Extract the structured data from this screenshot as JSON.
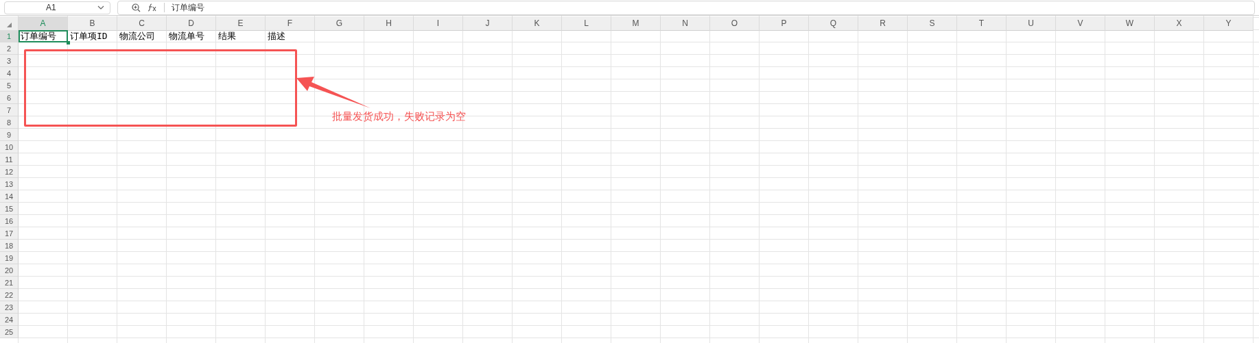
{
  "name_box": {
    "value": "A1"
  },
  "formula_bar": {
    "value": "订单编号"
  },
  "columns": [
    {
      "label": "A",
      "selected": true
    },
    {
      "label": "B",
      "selected": false
    },
    {
      "label": "C",
      "selected": false
    },
    {
      "label": "D",
      "selected": false
    },
    {
      "label": "E",
      "selected": false
    },
    {
      "label": "F",
      "selected": false
    },
    {
      "label": "G",
      "selected": false
    },
    {
      "label": "H",
      "selected": false
    },
    {
      "label": "I",
      "selected": false
    },
    {
      "label": "J",
      "selected": false
    },
    {
      "label": "K",
      "selected": false
    },
    {
      "label": "L",
      "selected": false
    },
    {
      "label": "M",
      "selected": false
    },
    {
      "label": "N",
      "selected": false
    },
    {
      "label": "O",
      "selected": false
    },
    {
      "label": "P",
      "selected": false
    },
    {
      "label": "Q",
      "selected": false
    },
    {
      "label": "R",
      "selected": false
    },
    {
      "label": "S",
      "selected": false
    },
    {
      "label": "T",
      "selected": false
    },
    {
      "label": "U",
      "selected": false
    },
    {
      "label": "V",
      "selected": false
    },
    {
      "label": "W",
      "selected": false
    },
    {
      "label": "X",
      "selected": false
    },
    {
      "label": "Y",
      "selected": false
    }
  ],
  "rows": [
    {
      "label": "1",
      "selected": true,
      "cells": [
        {
          "text": "订单编号",
          "selected": true
        },
        {
          "text": "订单项ID",
          "selected": false
        },
        {
          "text": "物流公司",
          "selected": false
        },
        {
          "text": "物流单号",
          "selected": false
        },
        {
          "text": "结果",
          "selected": false
        },
        {
          "text": "描述",
          "selected": false
        }
      ]
    },
    {
      "label": "2",
      "selected": false
    },
    {
      "label": "3",
      "selected": false
    },
    {
      "label": "4",
      "selected": false
    },
    {
      "label": "5",
      "selected": false
    },
    {
      "label": "6",
      "selected": false
    },
    {
      "label": "7",
      "selected": false
    },
    {
      "label": "8",
      "selected": false
    },
    {
      "label": "9",
      "selected": false
    },
    {
      "label": "10",
      "selected": false
    },
    {
      "label": "11",
      "selected": false
    },
    {
      "label": "12",
      "selected": false
    },
    {
      "label": "13",
      "selected": false
    },
    {
      "label": "14",
      "selected": false
    },
    {
      "label": "15",
      "selected": false
    },
    {
      "label": "16",
      "selected": false
    },
    {
      "label": "17",
      "selected": false
    },
    {
      "label": "18",
      "selected": false
    },
    {
      "label": "19",
      "selected": false
    },
    {
      "label": "20",
      "selected": false
    },
    {
      "label": "21",
      "selected": false
    },
    {
      "label": "22",
      "selected": false
    },
    {
      "label": "23",
      "selected": false
    },
    {
      "label": "24",
      "selected": false
    },
    {
      "label": "25",
      "selected": false
    }
  ],
  "annotation": {
    "text": "批量发货成功，失败记录为空"
  }
}
